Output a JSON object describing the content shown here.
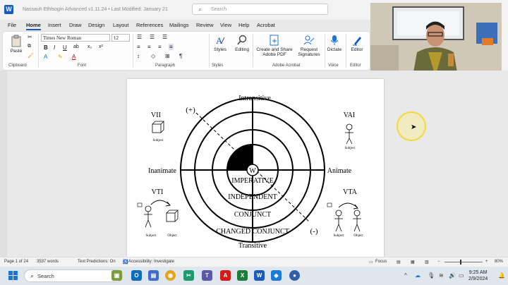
{
  "title_bar": {
    "app_letter": "W",
    "doc_title": "Nassauh Ethlsogin Arlvanced v1.11.24  •  Last Modified: January 21",
    "search_placeholder": "Search"
  },
  "tabs": [
    "File",
    "Home",
    "Insert",
    "Draw",
    "Design",
    "Layout",
    "References",
    "Mailings",
    "Review",
    "View",
    "Help",
    "Acrobat"
  ],
  "active_tab": "Home",
  "ribbon": {
    "paste_label": "Paste",
    "font_name": "Times New Roman",
    "font_size": "12",
    "groups": {
      "clipboard": "Clipboard",
      "font": "Font",
      "paragraph": "Paragraph",
      "styles": "Styles",
      "adobe": "Adobe Acrobat",
      "voice": "Voice",
      "editor_group": "Editor"
    },
    "styles_label": "Styles",
    "editing_label": "Editing",
    "create_share_1": "Create and Share",
    "create_share_2": "Adobe PDF",
    "request_1": "Request",
    "request_2": "Signatures",
    "dictate_label": "Dictate",
    "editor_label": "Editor",
    "format_buttons": [
      "B",
      "I",
      "U",
      "A",
      "A"
    ]
  },
  "diagram": {
    "top": "Intransitive",
    "bottom": "Transitive",
    "left": "Inanimate",
    "right": "Animate",
    "plus": "(+)",
    "minus": "(-)",
    "center": "W",
    "rings": [
      "IMPERATIVE",
      "INDEPENDENT",
      "CONJUNCT",
      "CHANGED CONJUNCT"
    ],
    "corners": {
      "vii": "VII",
      "vai": "VAI",
      "vti": "VTI",
      "vta": "VTA"
    },
    "subject": "Subject",
    "object": "Object"
  },
  "status_bar": {
    "page": "Page 1 of 24",
    "words": "3537 words",
    "predictions": "Text Predictions: On",
    "accessibility": "Accessibility: Investigate",
    "focus": "Focus",
    "zoom": "80%"
  },
  "taskbar": {
    "search": "Search",
    "time": "9:25 AM",
    "date": "2/9/2024"
  },
  "colors": {
    "word_blue": "#185abd",
    "taskbar": "#dfe6ee",
    "halo": "#f4d93a"
  }
}
